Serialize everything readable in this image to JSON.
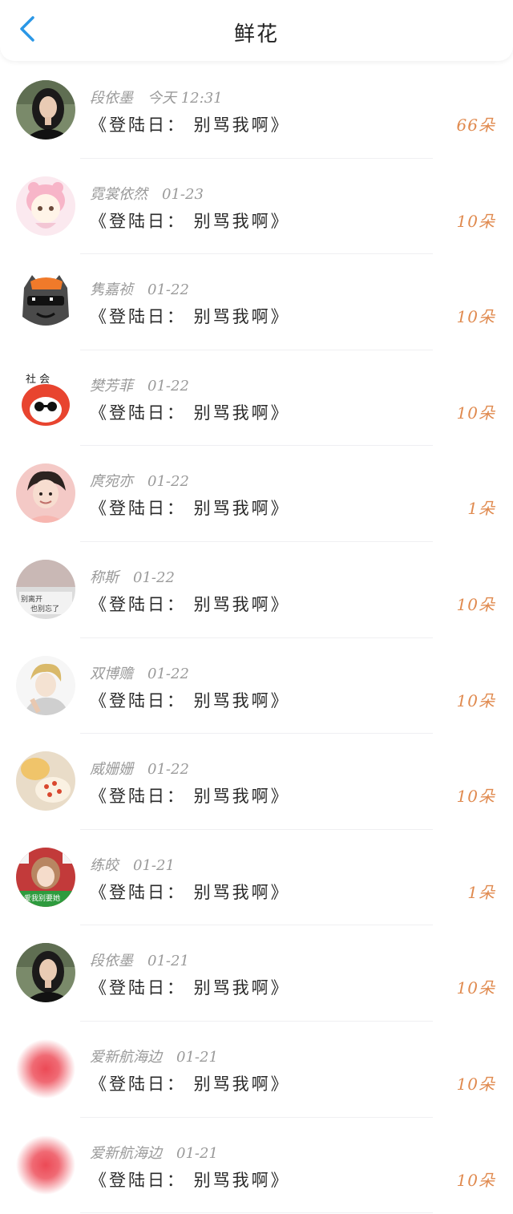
{
  "header": {
    "title": "鲜花",
    "back_icon": "chevron-left-icon",
    "accent_color": "#2a97e6"
  },
  "count_color": "#e08a4f",
  "items": [
    {
      "name": "段依墨",
      "time": "今天 12:31",
      "message": "《登陆日： 别骂我啊》",
      "count": "66朵",
      "avatar": "photo-woman"
    },
    {
      "name": "霓裳依然",
      "time": "01-23",
      "message": "《登陆日： 别骂我啊》",
      "count": "10朵",
      "avatar": "cartoon-pink"
    },
    {
      "name": "隽嘉祯",
      "time": "01-22",
      "message": "《登陆日： 别骂我啊》",
      "count": "10朵",
      "avatar": "cartoon-wolf-sunglasses"
    },
    {
      "name": "樊芳菲",
      "time": "01-22",
      "message": "《登陆日： 别骂我啊》",
      "count": "10朵",
      "avatar": "cartoon-red-sunglasses"
    },
    {
      "name": "庹宛亦",
      "time": "01-22",
      "message": "《登陆日： 别骂我啊》",
      "count": "1朵",
      "avatar": "anime-boy"
    },
    {
      "name": "称斯",
      "time": "01-22",
      "message": "《登陆日： 别骂我啊》",
      "count": "10朵",
      "avatar": "photo-text"
    },
    {
      "name": "双博赡",
      "time": "01-22",
      "message": "《登陆日： 别骂我啊》",
      "count": "10朵",
      "avatar": "anime-sketch"
    },
    {
      "name": "威姗姗",
      "time": "01-22",
      "message": "《登陆日： 别骂我啊》",
      "count": "10朵",
      "avatar": "photo-cake"
    },
    {
      "name": "练皎",
      "time": "01-21",
      "message": "《登陆日： 别骂我啊》",
      "count": "1朵",
      "avatar": "photo-girl-poker"
    },
    {
      "name": "段依墨",
      "time": "01-21",
      "message": "《登陆日： 别骂我啊》",
      "count": "10朵",
      "avatar": "photo-woman"
    },
    {
      "name": "爱新航海边",
      "time": "01-21",
      "message": "《登陆日： 别骂我啊》",
      "count": "10朵",
      "avatar": "blur-red"
    },
    {
      "name": "爱新航海边",
      "time": "01-21",
      "message": "《登陆日： 别骂我啊》",
      "count": "10朵",
      "avatar": "blur-red"
    }
  ]
}
